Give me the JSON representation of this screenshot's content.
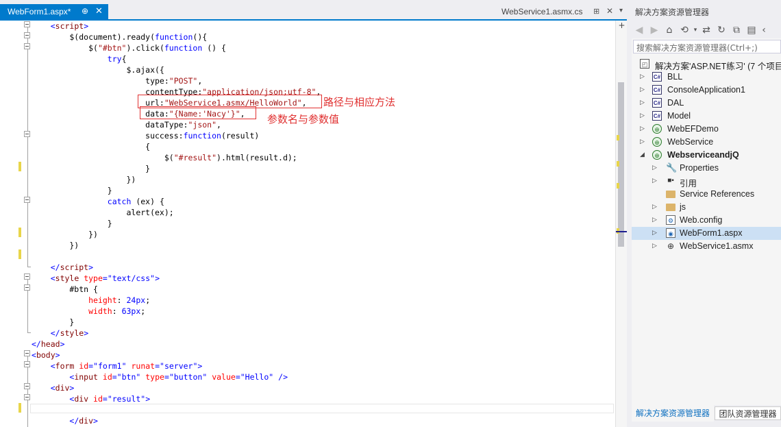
{
  "tabs": {
    "active": {
      "label": "WebForm1.aspx*",
      "pin": "⊕",
      "close": "✕"
    },
    "inactive": {
      "label": "WebService1.asmx.cs",
      "pin": "⊞",
      "close": "✕",
      "dropdown": "▾"
    }
  },
  "editor": {
    "lines": [
      [
        [
          "t-txt",
          "    "
        ],
        [
          "t-val",
          "<"
        ],
        [
          "t-tag",
          "script"
        ],
        [
          "t-val",
          ">"
        ]
      ],
      [
        [
          "t-txt",
          "        $(document).ready("
        ],
        [
          "t-kw",
          "function"
        ],
        [
          "t-txt",
          "(){"
        ]
      ],
      [
        [
          "t-txt",
          "            $("
        ],
        [
          "t-str",
          "\"#btn\""
        ],
        [
          "t-txt",
          ").click("
        ],
        [
          "t-kw",
          "function"
        ],
        [
          "t-txt",
          " () {"
        ]
      ],
      [
        [
          "t-txt",
          "                "
        ],
        [
          "t-kw",
          "try"
        ],
        [
          "t-txt",
          "{"
        ]
      ],
      [
        [
          "t-txt",
          "                    $.ajax({"
        ]
      ],
      [
        [
          "t-txt",
          "                        type:"
        ],
        [
          "t-str",
          "\"POST\""
        ],
        [
          "t-txt",
          ","
        ]
      ],
      [
        [
          "t-txt",
          "                        contentType:"
        ],
        [
          "t-str",
          "\"application/json;utf-8\""
        ],
        [
          "t-txt",
          ","
        ]
      ],
      [
        [
          "t-txt",
          "                        url:"
        ],
        [
          "t-str",
          "\"WebService1.asmx/HelloWorld\""
        ],
        [
          "t-txt",
          ","
        ]
      ],
      [
        [
          "t-txt",
          "                        data:"
        ],
        [
          "t-str",
          "\"{Name:'Nacy'}\""
        ],
        [
          "t-txt",
          ","
        ]
      ],
      [
        [
          "t-txt",
          "                        dataType:"
        ],
        [
          "t-str",
          "\"json\""
        ],
        [
          "t-txt",
          ","
        ]
      ],
      [
        [
          "t-txt",
          "                        success:"
        ],
        [
          "t-kw",
          "function"
        ],
        [
          "t-txt",
          "(result)"
        ]
      ],
      [
        [
          "t-txt",
          "                        {"
        ]
      ],
      [
        [
          "t-txt",
          "                            $("
        ],
        [
          "t-str",
          "\"#result\""
        ],
        [
          "t-txt",
          ").html(result.d);"
        ]
      ],
      [
        [
          "t-txt",
          "                        }"
        ]
      ],
      [
        [
          "t-txt",
          "                    })"
        ]
      ],
      [
        [
          "t-txt",
          "                }"
        ]
      ],
      [
        [
          "t-txt",
          "                "
        ],
        [
          "t-kw",
          "catch"
        ],
        [
          "t-txt",
          " (ex) {"
        ]
      ],
      [
        [
          "t-txt",
          "                    alert(ex);"
        ]
      ],
      [
        [
          "t-txt",
          "                }"
        ]
      ],
      [
        [
          "t-txt",
          "            })"
        ]
      ],
      [
        [
          "t-txt",
          "        })"
        ]
      ],
      [
        [
          "t-txt",
          ""
        ]
      ],
      [
        [
          "t-txt",
          "    "
        ],
        [
          "t-val",
          "</"
        ],
        [
          "t-tag",
          "script"
        ],
        [
          "t-val",
          ">"
        ]
      ],
      [
        [
          "t-txt",
          "    "
        ],
        [
          "t-val",
          "<"
        ],
        [
          "t-tag",
          "style"
        ],
        [
          "t-txt",
          " "
        ],
        [
          "t-attr",
          "type"
        ],
        [
          "t-val",
          "=\"text/css\">"
        ]
      ],
      [
        [
          "t-txt",
          "        #btn {"
        ]
      ],
      [
        [
          "t-txt",
          "            "
        ],
        [
          "t-attr",
          "height"
        ],
        [
          "t-txt",
          ": "
        ],
        [
          "t-val",
          "24px"
        ],
        [
          "t-txt",
          ";"
        ]
      ],
      [
        [
          "t-txt",
          "            "
        ],
        [
          "t-attr",
          "width"
        ],
        [
          "t-txt",
          ": "
        ],
        [
          "t-val",
          "63px"
        ],
        [
          "t-txt",
          ";"
        ]
      ],
      [
        [
          "t-txt",
          "        }"
        ]
      ],
      [
        [
          "t-txt",
          "    "
        ],
        [
          "t-val",
          "</"
        ],
        [
          "t-tag",
          "style"
        ],
        [
          "t-val",
          ">"
        ]
      ],
      [
        [
          "t-val",
          "</"
        ],
        [
          "t-tag",
          "head"
        ],
        [
          "t-val",
          ">"
        ]
      ],
      [
        [
          "t-val",
          "<"
        ],
        [
          "t-tag",
          "body"
        ],
        [
          "t-val",
          ">"
        ]
      ],
      [
        [
          "t-txt",
          "    "
        ],
        [
          "t-val",
          "<"
        ],
        [
          "t-tag",
          "form"
        ],
        [
          "t-txt",
          " "
        ],
        [
          "t-attr",
          "id"
        ],
        [
          "t-val",
          "=\"form1\""
        ],
        [
          "t-txt",
          " "
        ],
        [
          "t-attr",
          "runat"
        ],
        [
          "t-val",
          "=\"server\">"
        ]
      ],
      [
        [
          "t-txt",
          "        "
        ],
        [
          "t-val",
          "<"
        ],
        [
          "t-tag",
          "input"
        ],
        [
          "t-txt",
          " "
        ],
        [
          "t-attr",
          "id"
        ],
        [
          "t-val",
          "=\"btn\""
        ],
        [
          "t-txt",
          " "
        ],
        [
          "t-attr",
          "type"
        ],
        [
          "t-val",
          "=\"button\""
        ],
        [
          "t-txt",
          " "
        ],
        [
          "t-attr",
          "value"
        ],
        [
          "t-val",
          "=\"Hello\""
        ],
        [
          "t-txt",
          " "
        ],
        [
          "t-val",
          "/>"
        ]
      ],
      [
        [
          "t-txt",
          "    "
        ],
        [
          "t-val",
          "<"
        ],
        [
          "t-tag",
          "div"
        ],
        [
          "t-val",
          ">"
        ]
      ],
      [
        [
          "t-txt",
          "        "
        ],
        [
          "t-val",
          "<"
        ],
        [
          "t-tag",
          "div"
        ],
        [
          "t-txt",
          " "
        ],
        [
          "t-attr",
          "id"
        ],
        [
          "t-val",
          "=\"result\">"
        ]
      ],
      [
        [
          "t-txt",
          ""
        ]
      ],
      [
        [
          "t-txt",
          "        "
        ],
        [
          "t-val",
          "</"
        ],
        [
          "t-tag",
          "div"
        ],
        [
          "t-val",
          ">"
        ]
      ]
    ],
    "annotations": {
      "path_note": "路径与相应方法",
      "param_note": "参数名与参数值"
    }
  },
  "scrollbar": {
    "splitter": "+"
  },
  "solution_explorer": {
    "title": "解决方案资源管理器",
    "search_placeholder": "搜索解决方案资源管理器(Ctrl+;)",
    "solution_label": "解决方案'ASP.NET练习' (7 个项目)",
    "projects": [
      {
        "label": "BLL",
        "icon": "csharp-project-icon"
      },
      {
        "label": "ConsoleApplication1",
        "icon": "csharp-project-icon"
      },
      {
        "label": "DAL",
        "icon": "csharp-project-icon"
      },
      {
        "label": "Model",
        "icon": "csharp-project-icon"
      },
      {
        "label": "WebEFDemo",
        "icon": "web-project-icon"
      },
      {
        "label": "WebService",
        "icon": "web-project-icon"
      },
      {
        "label": "WebserviceandjQ",
        "icon": "web-project-icon"
      }
    ],
    "children": [
      {
        "label": "Properties",
        "icon": "wrench-icon"
      },
      {
        "label": "引用",
        "icon": "references-icon"
      },
      {
        "label": "Service References",
        "icon": "folder-icon"
      },
      {
        "label": "js",
        "icon": "folder-icon"
      },
      {
        "label": "Web.config",
        "icon": "config-file-icon"
      },
      {
        "label": "WebForm1.aspx",
        "icon": "aspx-file-icon"
      },
      {
        "label": "WebService1.asmx",
        "icon": "asmx-file-icon"
      }
    ],
    "bottom_tabs": {
      "active": "解决方案资源管理器",
      "inactive": "团队资源管理器"
    }
  }
}
